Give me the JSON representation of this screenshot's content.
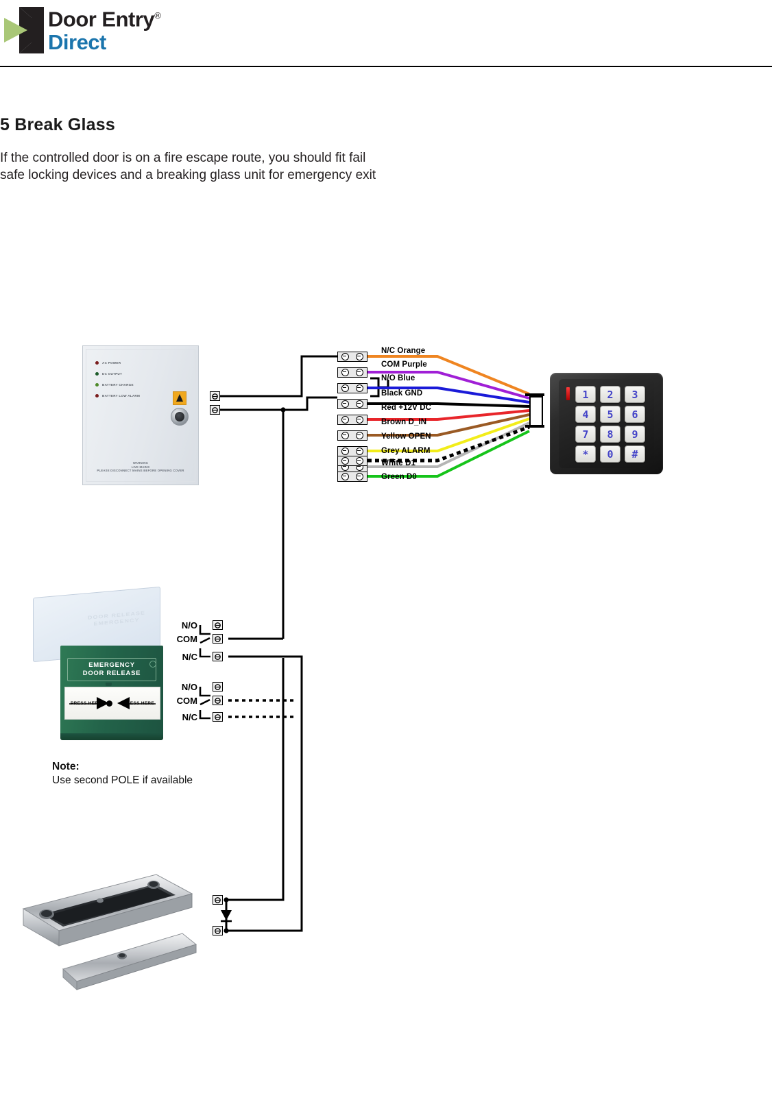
{
  "header": {
    "brand_line1": "Door Entry",
    "brand_line2": "Direct",
    "registered_mark": "®",
    "logo_icon": "door-entry-direct-logo",
    "colors": {
      "dark": "#231f20",
      "blue": "#1b75ad",
      "green": "#a9c777"
    }
  },
  "section": {
    "number_title": "5 Break Glass",
    "body": "If the controlled door is on a fire escape route, you should fit fail safe locking devices and a breaking glass unit for emergency exit"
  },
  "psu": {
    "name": "power-supply-unit",
    "leds": [
      {
        "label": "AC POWER",
        "color": "#7a1d1d"
      },
      {
        "label": "DC OUTPUT",
        "color": "#1d5c2a"
      },
      {
        "label": "BATTERY CHARGE",
        "color": "#4e8a2a"
      },
      {
        "label": "BATTERY LOW ALARM",
        "color": "#7a1d1d"
      }
    ],
    "hazard_icon": "high-voltage-warning-icon",
    "lock_icon": "key-lock-icon",
    "warning_lines": [
      "WARNING",
      "LIVE MAINS",
      "PLEASE DISCONNECT MAINS BEFORE OPENING COVER"
    ]
  },
  "wires": [
    {
      "label": "N/C Orange",
      "color": "#ef8521",
      "style": "solid"
    },
    {
      "label": "COM Purple",
      "color": "#a01fd6",
      "style": "solid"
    },
    {
      "label": "N/O Blue",
      "color": "#1a1ad8",
      "style": "solid"
    },
    {
      "label": "Black GND",
      "color": "#000000",
      "style": "solid"
    },
    {
      "label": "Red +12V DC",
      "color": "#e8252a",
      "style": "solid"
    },
    {
      "label": "Brown D_IN",
      "color": "#9a5a24",
      "style": "solid"
    },
    {
      "label": "Yellow OPEN",
      "color": "#f2ed1a",
      "style": "solid"
    },
    {
      "label": "Grey ALARM",
      "color": "#b5b5b5",
      "style": "solid"
    },
    {
      "label": "White D1",
      "color": "#000000",
      "style": "dotted"
    },
    {
      "label": "Green D0",
      "color": "#16c41a",
      "style": "solid"
    }
  ],
  "keypad": {
    "name": "access-control-keypad",
    "keys": [
      "1",
      "2",
      "3",
      "4",
      "5",
      "6",
      "7",
      "8",
      "9",
      "*",
      "0",
      "#"
    ],
    "led_indicator": "status-led",
    "connector": "cable-connector"
  },
  "breakglass": {
    "name": "emergency-break-glass-unit",
    "cover_text": "DOOR RELEASE EMERGENCY",
    "plate_line1": "EMERGENCY",
    "plate_line2": "DOOR RELEASE",
    "press_left": "PRESS HERE",
    "press_right": "PRESS HERE"
  },
  "relay_terminals": {
    "pole1": [
      "N/O",
      "COM",
      "N/C"
    ],
    "pole2": [
      "N/O",
      "COM",
      "N/C"
    ]
  },
  "note": {
    "title": "Note:",
    "text": "Use second POLE if available"
  },
  "maglock": {
    "name": "electromagnetic-lock",
    "diode_icon": "flyback-diode"
  }
}
